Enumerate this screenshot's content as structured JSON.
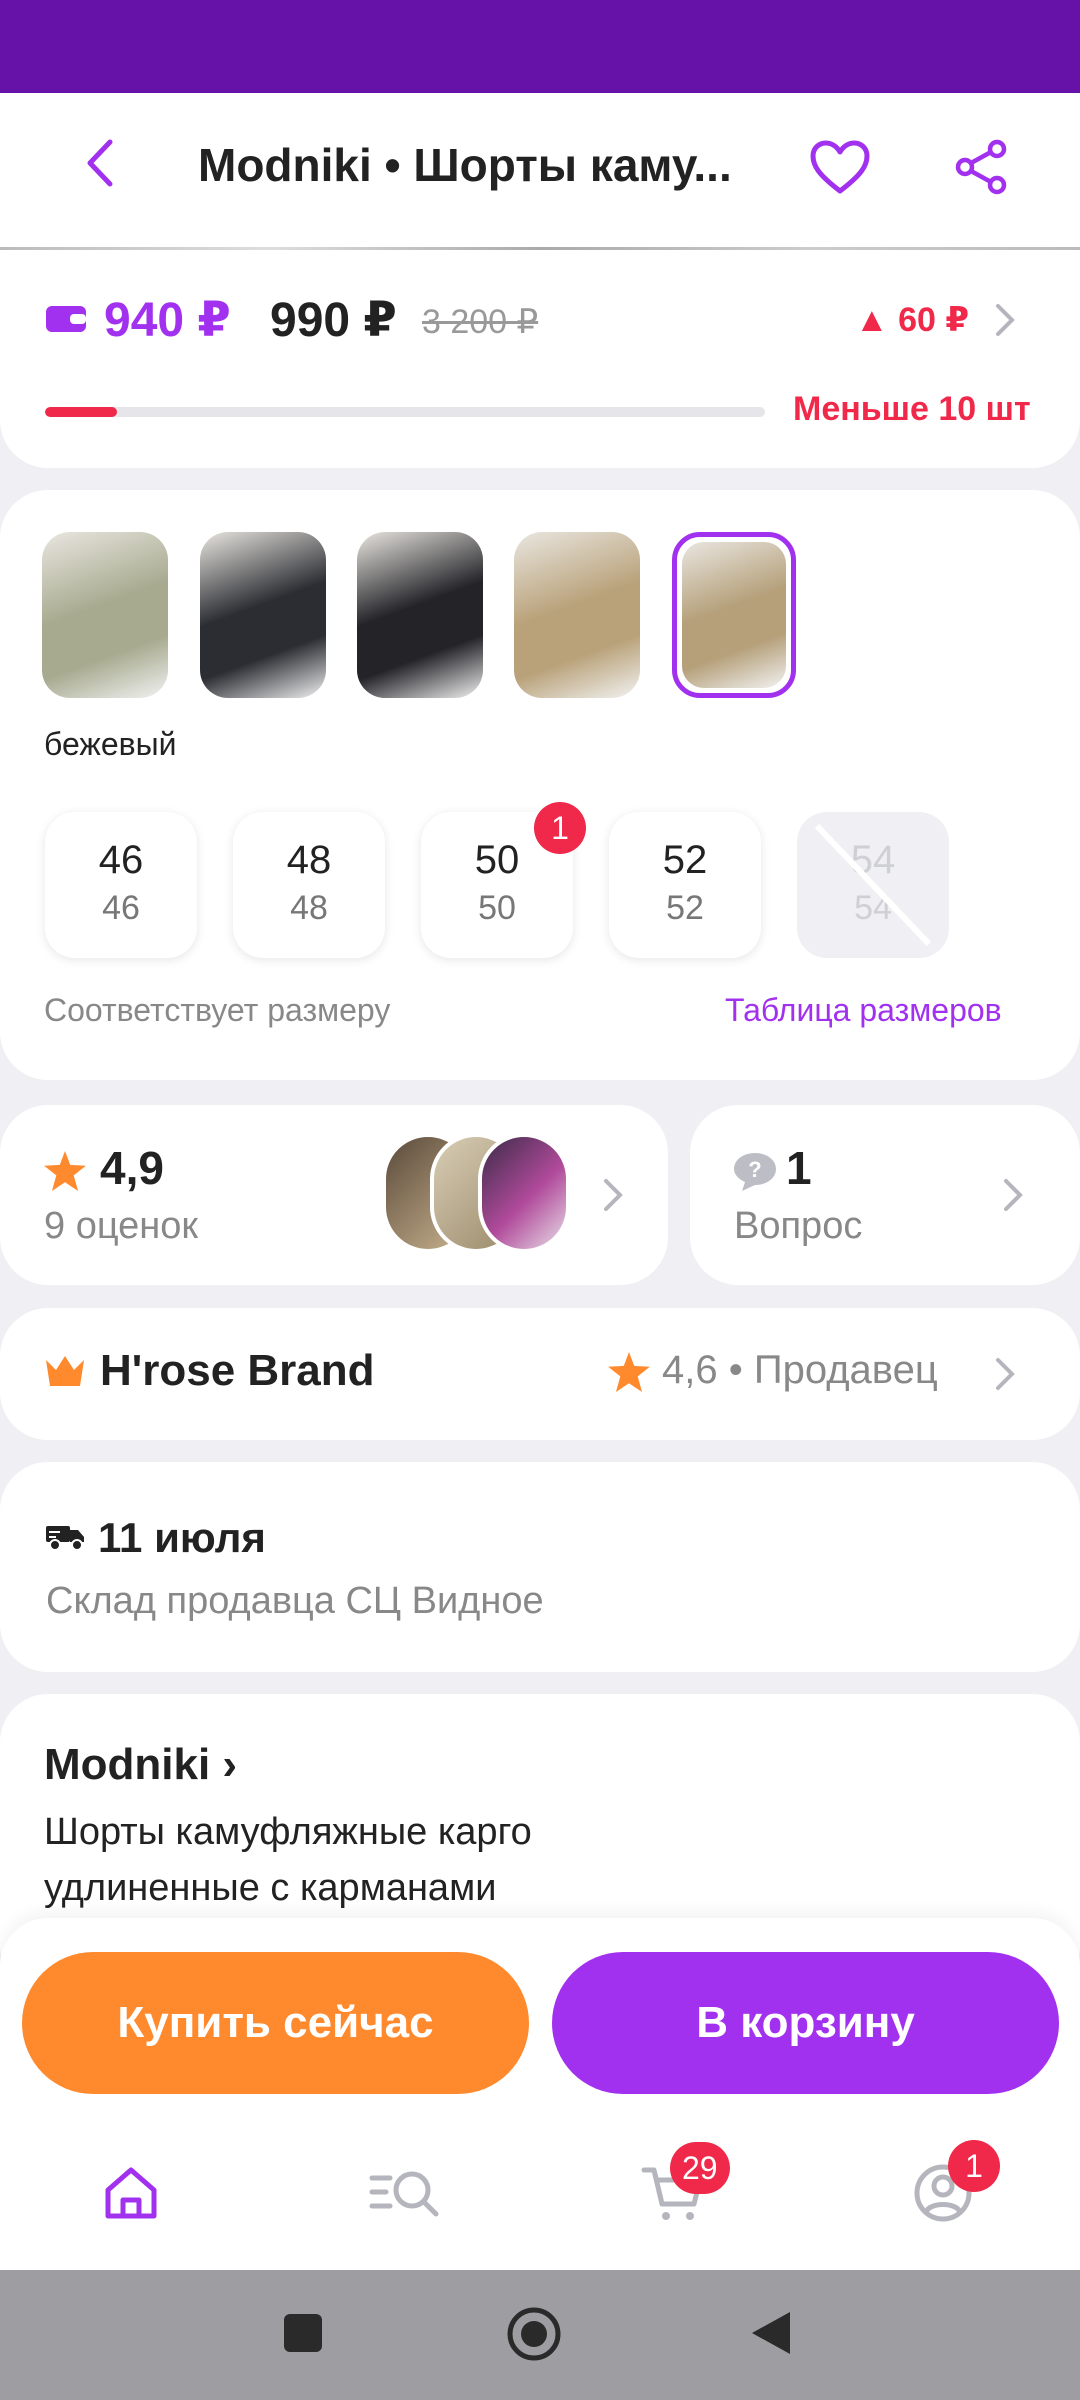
{
  "header": {
    "title": "Modniki • Шорты каму..."
  },
  "price": {
    "wallet_price": "940 ₽",
    "price": "990 ₽",
    "old_price": "3 200 ₽",
    "difference": "60 ₽",
    "stock_label": "Меньше 10 шт",
    "stock_level": 0.1
  },
  "colors": {
    "selected_label": "бежевый",
    "swatches": [
      {
        "name": "swatch-1",
        "color": "#a7aa8f"
      },
      {
        "name": "swatch-2",
        "color": "#2b2d33"
      },
      {
        "name": "swatch-3",
        "color": "#232328"
      },
      {
        "name": "swatch-4",
        "color": "#b9a27a"
      },
      {
        "name": "swatch-5",
        "color": "#b5a07a"
      }
    ]
  },
  "sizes": {
    "items": [
      {
        "top": "46",
        "bottom": "46",
        "available": true
      },
      {
        "top": "48",
        "bottom": "48",
        "available": true
      },
      {
        "top": "50",
        "bottom": "50",
        "available": true
      },
      {
        "top": "52",
        "bottom": "52",
        "available": true
      },
      {
        "top": "54",
        "bottom": "54",
        "available": false
      }
    ],
    "badge": "1",
    "fit_text": "Соответствует размеру",
    "table_link": "Таблица размеров"
  },
  "rating": {
    "value": "4,9",
    "count": "9 оценок"
  },
  "questions": {
    "count": "1",
    "label": "Вопрос"
  },
  "seller": {
    "name": "H'rose Brand",
    "rating": "4,6 • Продавец"
  },
  "delivery": {
    "date": "11 июля",
    "warehouse": "Склад продавца СЦ Видное"
  },
  "description": {
    "brand": "Modniki ›",
    "text": "Шорты камуфляжные карго удлиненные с карманами"
  },
  "actions": {
    "buy_now": "Купить сейчас",
    "add_to_cart": "В корзину"
  },
  "bottom_nav": {
    "home": "home-icon",
    "catalog": "catalog-search-icon",
    "cart": "cart-icon",
    "cart_badge": "29",
    "profile": "profile-icon",
    "profile_badge": "1"
  },
  "colors_theme": {
    "accent": "#a231ef",
    "status_bar": "#6612a8",
    "alert": "#f0284a",
    "buy": "#ff8a2e"
  }
}
